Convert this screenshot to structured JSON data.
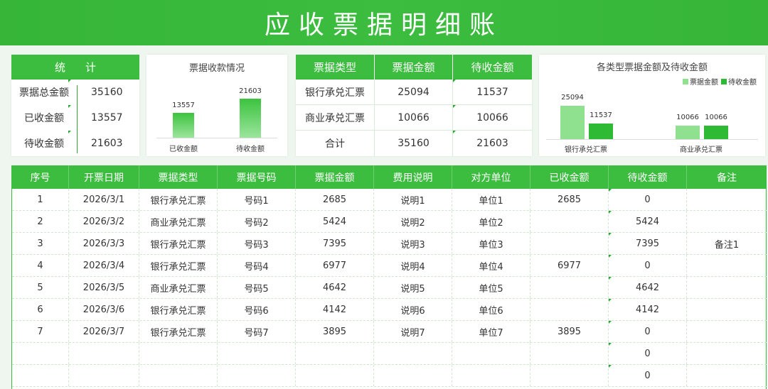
{
  "title": "应收票据明细账",
  "stats": {
    "header": "统计",
    "rows": [
      {
        "label": "票据总金额",
        "value": "35160"
      },
      {
        "label": "已收金额",
        "value": "13557"
      },
      {
        "label": "待收金额",
        "value": "21603"
      }
    ]
  },
  "collection_chart": {
    "title": "票据收款情况",
    "chart_data": {
      "type": "bar",
      "categories": [
        "已收金额",
        "待收金额"
      ],
      "values": [
        13557,
        21603
      ],
      "data_labels": [
        "13557",
        "21603"
      ]
    }
  },
  "type_table": {
    "headers": [
      "票据类型",
      "票据金额",
      "待收金额"
    ],
    "rows": [
      [
        "银行承兑汇票",
        "25094",
        "11537"
      ],
      [
        "商业承兑汇票",
        "10066",
        "10066"
      ],
      [
        "合计",
        "35160",
        "21603"
      ]
    ]
  },
  "type_chart": {
    "title": "各类型票据金额及待收金额",
    "legend": [
      "票据金额",
      "待收金额"
    ],
    "colors": {
      "票据金额": "#8fe08f",
      "待收金额": "#2fba36"
    },
    "chart_data": {
      "type": "bar",
      "categories": [
        "银行承兑汇票",
        "商业承兑汇票"
      ],
      "series": [
        {
          "name": "票据金额",
          "values": [
            25094,
            10066
          ]
        },
        {
          "name": "待收金额",
          "values": [
            11537,
            10066
          ]
        }
      ],
      "legend_position": "top-right"
    }
  },
  "detail": {
    "headers": [
      "序号",
      "开票日期",
      "票据类型",
      "票据号码",
      "票据金额",
      "费用说明",
      "对方单位",
      "已收金额",
      "待收金额",
      "备注"
    ],
    "rows": [
      [
        "1",
        "2026/3/1",
        "银行承兑汇票",
        "号码1",
        "2685",
        "说明1",
        "单位1",
        "2685",
        "0",
        ""
      ],
      [
        "2",
        "2026/3/2",
        "商业承兑汇票",
        "号码2",
        "5424",
        "说明2",
        "单位2",
        "",
        "5424",
        ""
      ],
      [
        "3",
        "2026/3/3",
        "银行承兑汇票",
        "号码3",
        "7395",
        "说明3",
        "单位3",
        "",
        "7395",
        "备注1"
      ],
      [
        "4",
        "2026/3/4",
        "银行承兑汇票",
        "号码4",
        "6977",
        "说明4",
        "单位4",
        "6977",
        "0",
        ""
      ],
      [
        "5",
        "2026/3/5",
        "商业承兑汇票",
        "号码5",
        "4642",
        "说明5",
        "单位5",
        "",
        "4642",
        ""
      ],
      [
        "6",
        "2026/3/6",
        "银行承兑汇票",
        "号码6",
        "4142",
        "说明6",
        "单位6",
        "",
        "4142",
        ""
      ],
      [
        "7",
        "2026/3/7",
        "银行承兑汇票",
        "号码7",
        "3895",
        "说明7",
        "单位7",
        "3895",
        "0",
        ""
      ],
      [
        "",
        "",
        "",
        "",
        "",
        "",
        "",
        "",
        "0",
        ""
      ],
      [
        "",
        "",
        "",
        "",
        "",
        "",
        "",
        "",
        "0",
        ""
      ]
    ]
  },
  "accent_color": "#3cbd3f"
}
